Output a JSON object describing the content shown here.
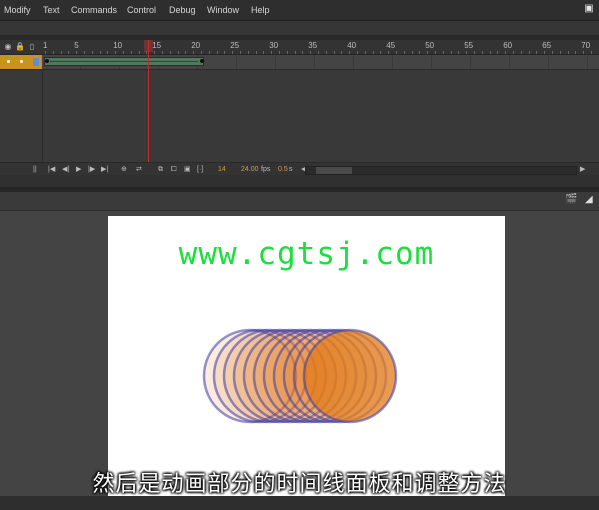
{
  "menu": {
    "items": [
      "Modify",
      "Text",
      "Commands",
      "Control",
      "Debug",
      "Window",
      "Help"
    ],
    "window_button": "▣"
  },
  "timeline": {
    "header_icons": [
      "eye-icon",
      "lock-icon",
      "outline-icon"
    ],
    "ruler_numbers": [
      "1",
      "5",
      "10",
      "15",
      "20",
      "25",
      "30",
      "35",
      "40",
      "45",
      "50",
      "55",
      "60",
      "65",
      "70"
    ],
    "current_frame": "14",
    "frame_rate": "24.00",
    "frame_rate_unit": "fps",
    "elapsed_time": "0.5",
    "elapsed_unit": "s",
    "footer_glyphs": {
      "pause": "||",
      "first": "|◀",
      "prev": "◀|",
      "play": "▶",
      "next": "|▶",
      "last": "▶|",
      "loop": "⇄",
      "center": "⊕",
      "onion": "⧉",
      "onion_outline": "⧠",
      "edit_multiple": "▣",
      "modify_markers": "[·]",
      "scroll_left": "◀",
      "scroll_right": "▶"
    }
  },
  "stage": {
    "toolbar_icons": [
      "clapper-icon",
      "camera-icon"
    ],
    "toolbar_glyphs": {
      "clapper": "🎬",
      "camera": "◢"
    },
    "canvas_text": "www.cgtsj.com",
    "text_color": "#19e03c",
    "circle_fill": "#e07a1a",
    "circle_stroke": "#3a3aa8"
  },
  "subtitle": "然后是动画部分的时间线面板和调整方法"
}
